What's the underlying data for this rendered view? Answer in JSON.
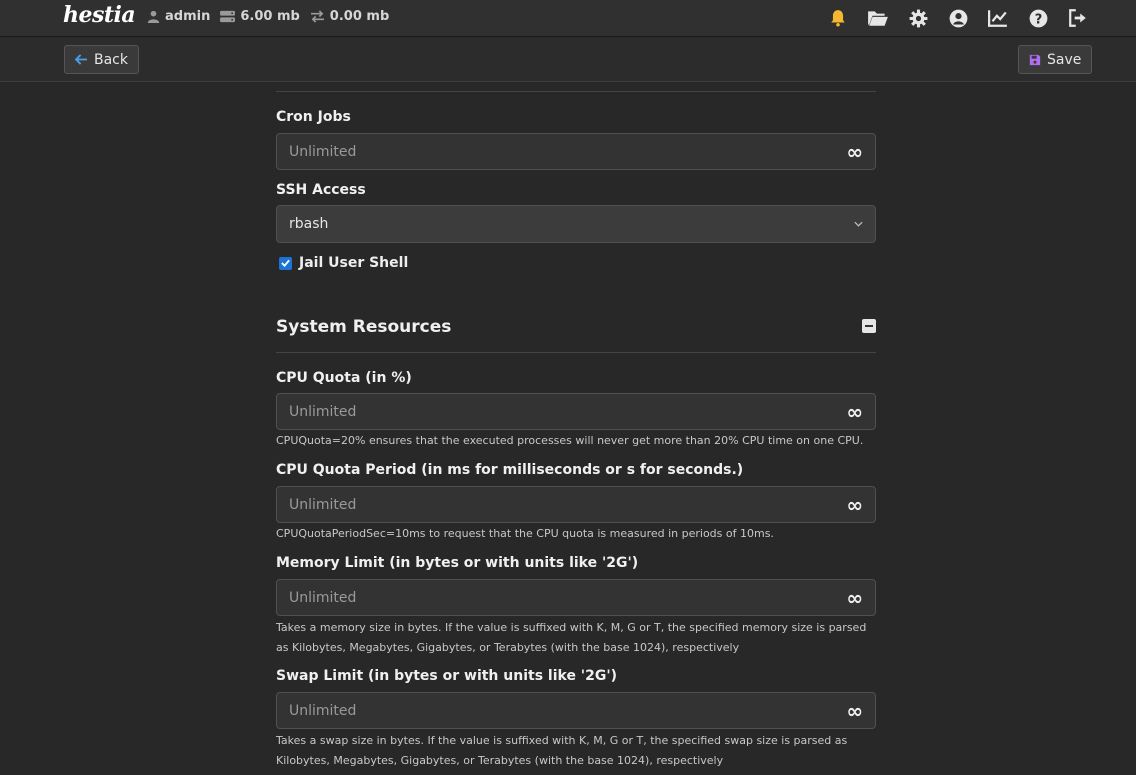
{
  "topbar": {
    "logo_text": "hestia",
    "user": "admin",
    "disk": "6.00 mb",
    "bandwidth": "0.00 mb",
    "icons": [
      "bell-icon",
      "folder-open-icon",
      "gear-icon",
      "user-circle-icon",
      "chart-line-icon",
      "question-circle-icon",
      "logout-icon"
    ]
  },
  "actions": {
    "back_label": "Back",
    "save_label": "Save"
  },
  "form": {
    "cron_jobs": {
      "label": "Cron Jobs",
      "placeholder": "Unlimited",
      "icon": "infinity-icon"
    },
    "ssh_access": {
      "label": "SSH Access",
      "value": "rbash"
    },
    "jail_shell": {
      "label": "Jail User Shell",
      "checked": true
    },
    "system_resources": {
      "title": "System Resources",
      "cpu_quota": {
        "label": "CPU Quota (in %)",
        "placeholder": "Unlimited",
        "help": "CPUQuota=20% ensures that the executed processes will never get more than 20% CPU time on one CPU."
      },
      "cpu_quota_period": {
        "label": "CPU Quota Period (in ms for milliseconds or s for seconds.)",
        "placeholder": "Unlimited",
        "help": "CPUQuotaPeriodSec=10ms to request that the CPU quota is measured in periods of 10ms."
      },
      "memory_limit": {
        "label": "Memory Limit (in bytes or with units like '2G')",
        "placeholder": "Unlimited",
        "help": "Takes a memory size in bytes. If the value is suffixed with K, M, G or T, the specified memory size is parsed as Kilobytes, Megabytes, Gigabytes, or Terabytes (with the base 1024), respectively"
      },
      "swap_limit": {
        "label": "Swap Limit (in bytes or with units like '2G')",
        "placeholder": "Unlimited",
        "help": "Takes a swap size in bytes. If the value is suffixed with K, M, G or T, the specified swap size is parsed as Kilobytes, Megabytes, Gigabytes, or Terabytes (with the base 1024), respectively"
      }
    }
  },
  "colors": {
    "background": "#282828",
    "accent_blue": "#4a9fe8",
    "bell_yellow": "#f5b82e",
    "save_purple": "#b06ef0"
  }
}
